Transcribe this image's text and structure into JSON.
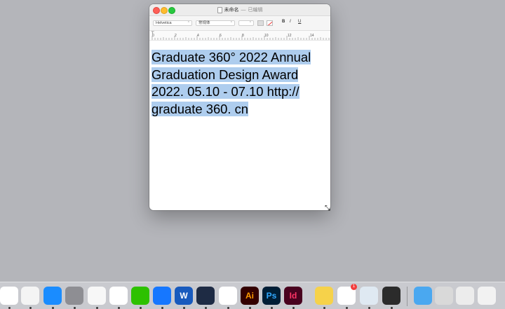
{
  "window": {
    "title": "未命名",
    "title_separator": "—",
    "status": "已编辑"
  },
  "formatbar": {
    "font": "Helvetica",
    "style": "常规体",
    "size": "",
    "bold": "B",
    "italic": "I",
    "underline": "U"
  },
  "ruler": {
    "tab_marker": "⊤",
    "numbers": [
      "0",
      "2",
      "4",
      "6",
      "8",
      "10",
      "12",
      "14"
    ]
  },
  "document": {
    "text_line1": "Graduate 360° 2022 Annual",
    "text_line2": "Graduation Design Award",
    "text_line3": "2022. 05.10 - 07.10 http://",
    "text_line4": "graduate 360. cn",
    "selection_color": "#aecdee"
  },
  "dock": {
    "apps": [
      {
        "name": "keynote",
        "icon": "keynote-icon",
        "color": "#ffffff",
        "label": ""
      },
      {
        "name": "pages",
        "icon": "pages-icon",
        "color": "#f4f4f4",
        "label": ""
      },
      {
        "name": "app-store",
        "icon": "app-store-icon",
        "color": "#1a8cff",
        "label": ""
      },
      {
        "name": "system-settings",
        "icon": "gear-icon",
        "color": "#8e8e93",
        "label": ""
      },
      {
        "name": "textedit",
        "icon": "textedit-icon",
        "color": "#f7f7f7",
        "label": ""
      },
      {
        "name": "qq-browser",
        "icon": "qq-browser-icon",
        "color": "#ffffff",
        "label": ""
      },
      {
        "name": "wechat",
        "icon": "wechat-icon",
        "color": "#2dc100",
        "label": ""
      },
      {
        "name": "lanhu",
        "icon": "lanhu-icon",
        "color": "#1677ff",
        "label": ""
      },
      {
        "name": "word",
        "icon": "word-icon",
        "color": "#185abd",
        "label": "W"
      },
      {
        "name": "clock",
        "icon": "clock-icon",
        "color": "#1e2b44",
        "label": ""
      },
      {
        "name": "baidu-netdisk",
        "icon": "cloud-icon",
        "color": "#ffffff",
        "label": ""
      },
      {
        "name": "illustrator",
        "icon": "illustrator-icon",
        "color": "#330000",
        "label": "Ai"
      },
      {
        "name": "photoshop",
        "icon": "photoshop-icon",
        "color": "#001e36",
        "label": "Ps"
      },
      {
        "name": "indesign",
        "icon": "indesign-icon",
        "color": "#49021f",
        "label": "Id"
      },
      {
        "name": "notes",
        "icon": "notes-icon",
        "color": "#f6d24a",
        "label": ""
      },
      {
        "name": "microsoft-store",
        "icon": "store-icon",
        "color": "#ffffff",
        "label": ""
      },
      {
        "name": "preview",
        "icon": "preview-icon",
        "color": "#dfe9f2",
        "label": ""
      },
      {
        "name": "quicktime",
        "icon": "quicktime-icon",
        "color": "#2b2b2b",
        "label": ""
      },
      {
        "name": "folder",
        "icon": "folder-icon",
        "color": "#4aa8f0",
        "label": ""
      },
      {
        "name": "window-thumb-1",
        "icon": "window-thumbnail-icon",
        "color": "#d9d9d9",
        "label": ""
      },
      {
        "name": "window-thumb-2",
        "icon": "window-thumbnail-icon",
        "color": "#ececec",
        "label": ""
      },
      {
        "name": "window-thumb-3",
        "icon": "window-thumbnail-icon",
        "color": "#f2f2f2",
        "label": ""
      }
    ],
    "badge_count": "1"
  }
}
